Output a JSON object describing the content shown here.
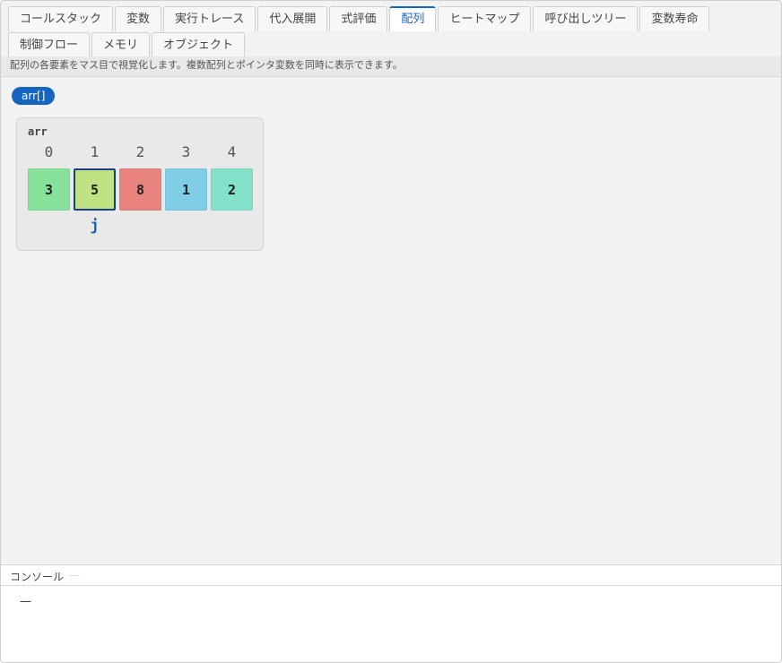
{
  "tabs": [
    {
      "label": "コールスタック",
      "active": false
    },
    {
      "label": "変数",
      "active": false
    },
    {
      "label": "実行トレース",
      "active": false
    },
    {
      "label": "代入展開",
      "active": false
    },
    {
      "label": "式評価",
      "active": false
    },
    {
      "label": "配列",
      "active": true
    },
    {
      "label": "ヒートマップ",
      "active": false
    },
    {
      "label": "呼び出しツリー",
      "active": false
    },
    {
      "label": "変数寿命",
      "active": false
    },
    {
      "label": "制御フロー",
      "active": false
    },
    {
      "label": "メモリ",
      "active": false
    },
    {
      "label": "オブジェクト",
      "active": false
    }
  ],
  "description": "配列の各要素をマス目で視覚化します。複数配列とポインタ変数を同時に表示できます。",
  "array_chip": "arr[]",
  "array": {
    "name": "arr",
    "indices": [
      "0",
      "1",
      "2",
      "3",
      "4"
    ],
    "values": [
      "3",
      "5",
      "8",
      "1",
      "2"
    ],
    "cell_colors": [
      "#86e29a",
      "#bfe383",
      "#e8837e",
      "#80cde6",
      "#82e1c8"
    ],
    "highlight_index": 1,
    "pointer": {
      "name": "j",
      "index": 1
    }
  },
  "console": {
    "label": "コンソール",
    "output": "—"
  }
}
